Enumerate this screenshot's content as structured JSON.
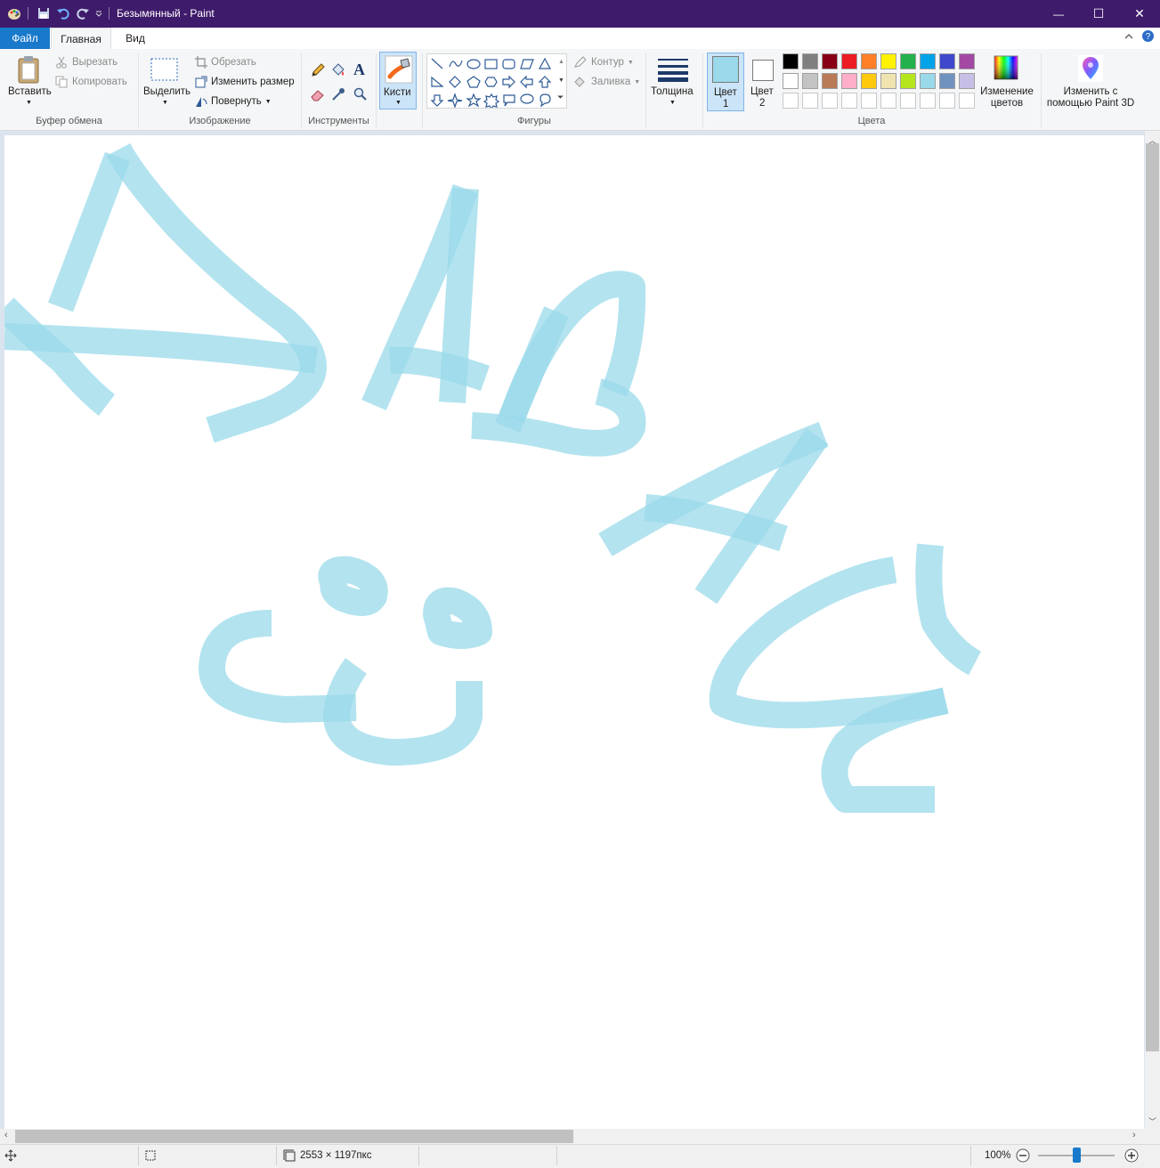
{
  "window": {
    "title": "Безымянный - Paint",
    "minimize_glyph": "—",
    "maximize_glyph": "☐",
    "close_glyph": "✕"
  },
  "tabs": {
    "file": "Файл",
    "home": "Главная",
    "view": "Вид"
  },
  "clipboard": {
    "paste": "Вставить",
    "cut": "Вырезать",
    "copy": "Копировать",
    "group": "Буфер обмена"
  },
  "image": {
    "select": "Выделить",
    "crop": "Обрезать",
    "resize": "Изменить размер",
    "rotate": "Повернуть",
    "group": "Изображение"
  },
  "tools": {
    "group": "Инструменты",
    "text_glyph": "A"
  },
  "brushes": {
    "label": "Кисти"
  },
  "shapes": {
    "outline": "Контур",
    "fill": "Заливка",
    "group": "Фигуры"
  },
  "size": {
    "label": "Толщина"
  },
  "colors": {
    "color1_label": "Цвет",
    "color1_num": "1",
    "color2_label": "Цвет",
    "color2_num": "2",
    "edit_line1": "Изменение",
    "edit_line2": "цветов",
    "group": "Цвета",
    "color1": "#99d9ea",
    "color2": "#ffffff",
    "palette_row1": [
      "#000000",
      "#7f7f7f",
      "#880015",
      "#ed1c24",
      "#ff7f27",
      "#fff200",
      "#22b14c",
      "#00a2e8",
      "#3f48cc",
      "#a349a4"
    ],
    "palette_row2": [
      "#ffffff",
      "#c3c3c3",
      "#b97a57",
      "#ffaec9",
      "#ffc90e",
      "#efe4b0",
      "#b5e61d",
      "#99d9ea",
      "#7092be",
      "#c8bfe7"
    ],
    "palette_row3": [
      "#ffffff",
      "#ffffff",
      "#ffffff",
      "#ffffff",
      "#ffffff",
      "#ffffff",
      "#ffffff",
      "#ffffff",
      "#ffffff",
      "#ffffff"
    ]
  },
  "paint3d": {
    "line1": "Изменить с",
    "line2": "помощью Paint 3D"
  },
  "status": {
    "dimensions": "2553 × 1197пкс",
    "zoom": "100%",
    "zoom_level": 1.0
  }
}
